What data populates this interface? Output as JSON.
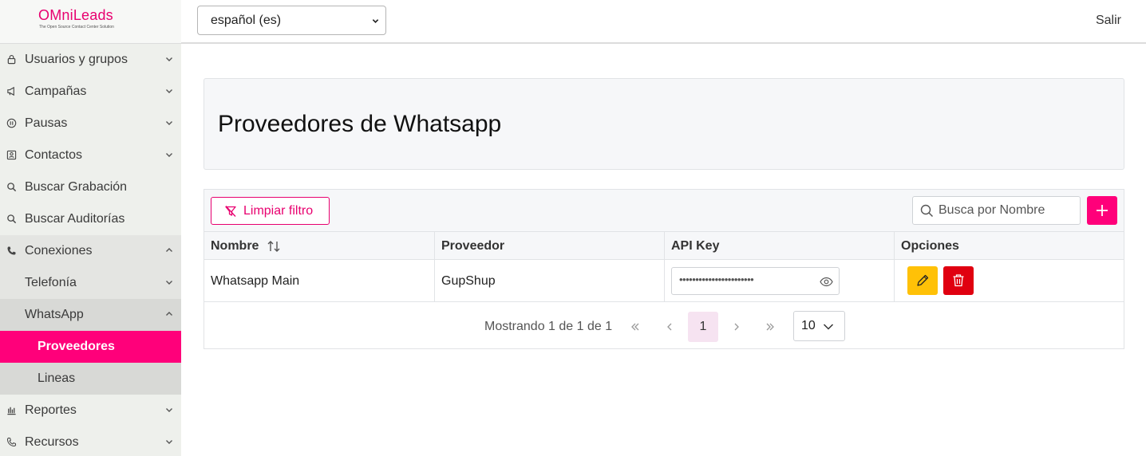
{
  "brand": {
    "name_om": "OMni",
    "name_rest": "Leads",
    "tagline": "The Open Source Contact Center Solution"
  },
  "topbar": {
    "language": "español (es)",
    "logout": "Salir"
  },
  "sidebar": {
    "items": [
      {
        "label": "Usuarios y grupos",
        "icon": "lock-icon"
      },
      {
        "label": "Campañas",
        "icon": "megaphone-icon"
      },
      {
        "label": "Pausas",
        "icon": "pause-icon"
      },
      {
        "label": "Contactos",
        "icon": "contacts-icon"
      },
      {
        "label": "Buscar Grabación",
        "icon": "search-icon"
      },
      {
        "label": "Buscar Auditorías",
        "icon": "search-icon"
      },
      {
        "label": "Conexiones",
        "icon": "phone-icon"
      },
      {
        "label": "Telefonía"
      },
      {
        "label": "WhatsApp"
      },
      {
        "label": "Proveedores"
      },
      {
        "label": "Lineas"
      },
      {
        "label": "Reportes",
        "icon": "chart-icon"
      },
      {
        "label": "Recursos",
        "icon": "phone-icon"
      }
    ]
  },
  "page": {
    "title": "Proveedores de Whatsapp"
  },
  "toolbar": {
    "clear_filter": "Limpiar filtro",
    "search_placeholder": "Busca por Nombre"
  },
  "table": {
    "columns": [
      "Nombre",
      "Proveedor",
      "API Key",
      "Opciones"
    ],
    "rows": [
      {
        "nombre": "Whatsapp Main",
        "proveedor": "GupShup",
        "api_key_masked": "•••••••••••••••••••••••"
      }
    ]
  },
  "pagination": {
    "info": "Mostrando 1 de 1 de 1",
    "current_page": "1",
    "rows_per_page": "10"
  },
  "colors": {
    "accent": "#ff007a",
    "edit": "#ffc107",
    "delete": "#e00010"
  }
}
